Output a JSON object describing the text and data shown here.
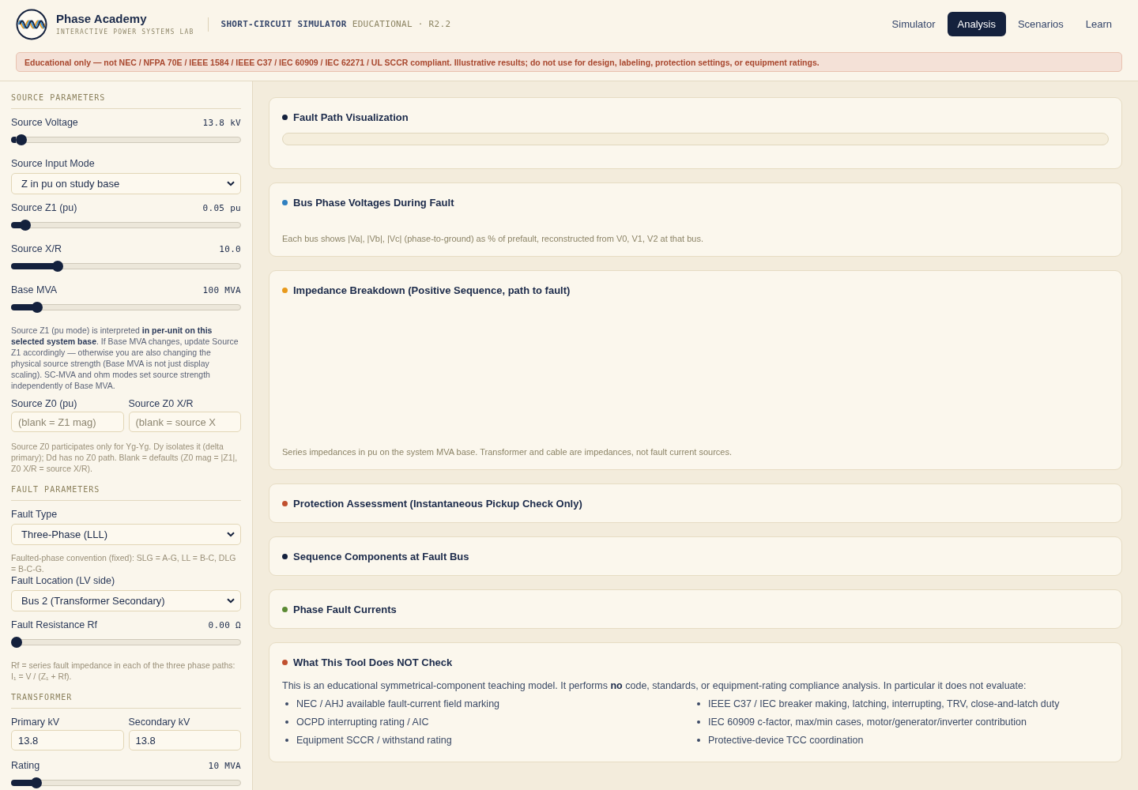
{
  "header": {
    "brand": {
      "title": "Phase Academy",
      "subtitle": "INTERACTIVE POWER SYSTEMS LAB"
    },
    "app_name": "SHORT-CIRCUIT SIMULATOR",
    "app_tag": "EDUCATIONAL · R2.2",
    "nav": [
      {
        "label": "Simulator",
        "selected": false
      },
      {
        "label": "Analysis",
        "selected": true
      },
      {
        "label": "Scenarios",
        "selected": false
      },
      {
        "label": "Learn",
        "selected": false
      }
    ]
  },
  "banner": "Educational only — not NEC / NFPA 70E / IEEE 1584 / IEEE C37 / IEC 60909 / IEC 62271 / UL SCCR compliant. Illustrative results; do not use for design, labeling, protection settings, or equipment ratings.",
  "sidebar": {
    "sections": [
      {
        "title": "SOURCE PARAMETERS",
        "items": [
          {
            "kind": "slider",
            "label": "Source Voltage",
            "reading": "13.8 kV",
            "level": 0.022
          },
          {
            "kind": "select",
            "label": "Source Input Mode",
            "value": "Z in pu on study base"
          },
          {
            "kind": "slider",
            "label": "Source Z1 (pu)",
            "reading": "0.05 pu",
            "level": 0.04
          },
          {
            "kind": "slider",
            "label": "Source X/R",
            "reading": "10.0",
            "level": 0.186
          },
          {
            "kind": "slider",
            "label": "Base MVA",
            "reading": "100 MVA",
            "level": 0.095
          },
          {
            "kind": "note",
            "text": "Source Z1 (pu mode) is interpreted **in per-unit on this selected system base**. If Base MVA changes, update Source Z1 accordingly — otherwise you are also changing the physical source strength (Base MVA is not just display scaling). SC-MVA and ohm modes set source strength independently of Base MVA."
          },
          {
            "kind": "fields",
            "fields": [
              {
                "label": "Source Z0 (pu)",
                "placeholder": "(blank = Z1 mag)"
              },
              {
                "label": "Source Z0 X/R",
                "placeholder": "(blank = source X"
              }
            ]
          },
          {
            "kind": "hint",
            "text": "Source Z0 participates only for Yg-Yg. Dy isolates it (delta primary); Dd has no Z0 path. Blank = defaults (Z0 mag = |Z1|, Z0 X/R = source X/R)."
          }
        ]
      },
      {
        "title": "FAULT PARAMETERS",
        "items": [
          {
            "kind": "select",
            "label": "Fault Type",
            "value": "Three-Phase (LLL)"
          },
          {
            "kind": "hint",
            "text": "Faulted-phase convention (fixed): SLG = A-G, LL = B-C, DLG = B-C-G."
          },
          {
            "kind": "select",
            "label": "Fault Location (LV side)",
            "value": "Bus 2 (Transformer Secondary)"
          },
          {
            "kind": "slider",
            "label": "Fault Resistance Rf",
            "reading": "0.00 Ω",
            "level": 0
          },
          {
            "kind": "hint",
            "text": "Rf = series fault impedance in each of the three phase paths: I₁ = V / (Z₁ + Rf)."
          }
        ]
      },
      {
        "title": "TRANSFORMER",
        "items": [
          {
            "kind": "fields",
            "fields": [
              {
                "label": "Primary kV",
                "value": "13.8"
              },
              {
                "label": "Secondary kV",
                "value": "13.8"
              }
            ]
          },
          {
            "kind": "slider",
            "label": "Rating",
            "reading": "10 MVA",
            "level": 0.09
          }
        ]
      }
    ]
  },
  "cards": [
    {
      "kind": "strip",
      "title": "Fault Path Visualization",
      "color": "#14213d"
    },
    {
      "kind": "note",
      "title": "Bus Phase Voltages During Fault",
      "color": "#2f80c0",
      "note": "Each bus shows |Va|, |Vb|, |Vc| (phase-to-ground) as % of prefault, reconstructed from V0, V1, V2 at that bus."
    },
    {
      "kind": "panel",
      "title": "Impedance Breakdown (Positive Sequence, path to fault)",
      "color": "#e89a1c",
      "note": "Series impedances in pu on the system MVA base. Transformer and cable are impedances, not fault current sources."
    },
    {
      "kind": "plain",
      "title": "Protection Assessment (Instantaneous Pickup Check Only)",
      "color": "#c0502f"
    },
    {
      "kind": "plain",
      "title": "Sequence Components at Fault Bus",
      "color": "#14213d"
    },
    {
      "kind": "plain",
      "title": "Phase Fault Currents",
      "color": "#5b8a34"
    },
    {
      "kind": "list",
      "title": "What This Tool Does NOT Check",
      "color": "#c0502f",
      "intro": "This is an educational symmetrical-component teaching model. It performs **no** code, standards, or equipment-rating compliance analysis. In particular it does not evaluate:",
      "items": [
        "NEC / AHJ available fault-current field marking",
        "OCPD interrupting rating / AIC",
        "Equipment SCCR / withstand rating",
        "IEEE C37 / IEC breaker making, latching, interrupting, TRV, close-and-latch duty",
        "IEC 60909 c-factor, max/min cases, motor/generator/inverter contribution",
        "Protective-device TCC coordination"
      ]
    }
  ]
}
